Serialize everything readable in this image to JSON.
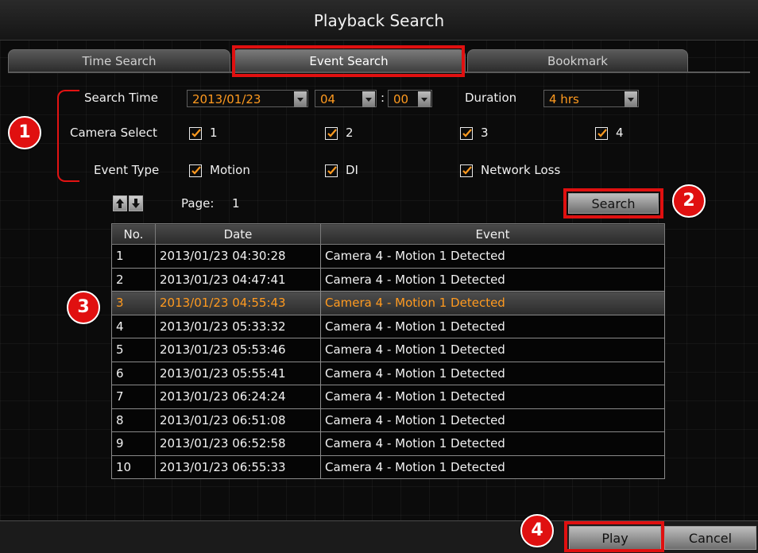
{
  "window": {
    "title": "Playback Search"
  },
  "tabs": [
    {
      "label": "Time Search",
      "active": false
    },
    {
      "label": "Event Search",
      "active": true
    },
    {
      "label": "Bookmark",
      "active": false
    }
  ],
  "form": {
    "search_time_label": "Search Time",
    "date_value": "2013/01/23",
    "hour_value": "04",
    "time_sep": ":",
    "minute_value": "00",
    "duration_label": "Duration",
    "duration_value": "4 hrs",
    "camera_select_label": "Camera Select",
    "cameras": [
      "1",
      "2",
      "3",
      "4"
    ],
    "event_type_label": "Event Type",
    "event_types": [
      "Motion",
      "DI",
      "Network Loss"
    ]
  },
  "pager": {
    "page_label": "Page:",
    "page_value": "1",
    "up_icon": "arrow-up-icon",
    "down_icon": "arrow-down-icon"
  },
  "search_button": "Search",
  "table": {
    "columns": [
      "No.",
      "Date",
      "Event"
    ],
    "selected_row": 2,
    "rows": [
      [
        "1",
        "2013/01/23 04:30:28",
        "Camera 4 - Motion 1 Detected"
      ],
      [
        "2",
        "2013/01/23 04:47:41",
        "Camera 4 - Motion 1 Detected"
      ],
      [
        "3",
        "2013/01/23 04:55:43",
        "Camera 4 - Motion 1 Detected"
      ],
      [
        "4",
        "2013/01/23 05:33:32",
        "Camera 4 - Motion 1 Detected"
      ],
      [
        "5",
        "2013/01/23 05:53:46",
        "Camera 4 - Motion 1 Detected"
      ],
      [
        "6",
        "2013/01/23 05:55:41",
        "Camera 4 - Motion 1 Detected"
      ],
      [
        "7",
        "2013/01/23 06:24:24",
        "Camera 4 - Motion 1 Detected"
      ],
      [
        "8",
        "2013/01/23 06:51:08",
        "Camera 4 - Motion 1 Detected"
      ],
      [
        "9",
        "2013/01/23 06:52:58",
        "Camera 4 - Motion 1 Detected"
      ],
      [
        "10",
        "2013/01/23 06:55:33",
        "Camera 4 - Motion 1 Detected"
      ]
    ]
  },
  "footer": {
    "play_label": "Play",
    "cancel_label": "Cancel"
  },
  "callouts": [
    "1",
    "2",
    "3",
    "4"
  ],
  "colors": {
    "highlight": "#ff9a1f",
    "callout_red": "#e01010",
    "background": "#0b0b0b"
  }
}
